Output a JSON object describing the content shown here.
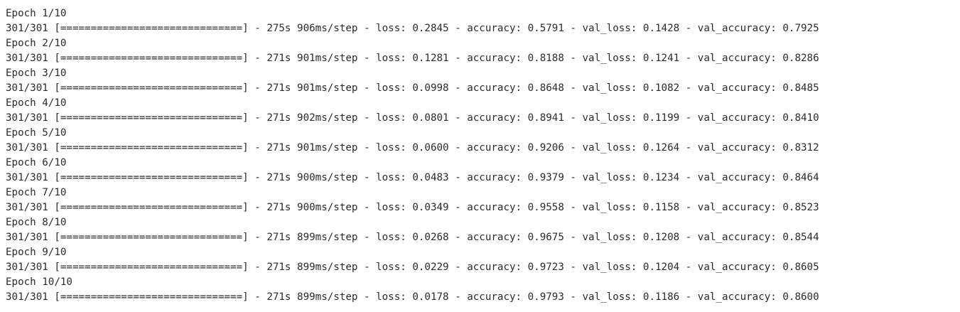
{
  "output": {
    "epochs": [
      {
        "header": "Epoch 1/10",
        "progress": {
          "text": "301/301",
          "fraction": 1.0
        },
        "bar": "[==============================]",
        "time": "275s",
        "step_time": "906ms/step",
        "loss": "0.2845",
        "accuracy": "0.5791",
        "val_loss": "0.1428",
        "val_accuracy": "0.7925"
      },
      {
        "header": "Epoch 2/10",
        "progress": {
          "text": "301/301",
          "fraction": 1.0
        },
        "bar": "[==============================]",
        "time": "271s",
        "step_time": "901ms/step",
        "loss": "0.1281",
        "accuracy": "0.8188",
        "val_loss": "0.1241",
        "val_accuracy": "0.8286"
      },
      {
        "header": "Epoch 3/10",
        "progress": {
          "text": "301/301",
          "fraction": 1.0
        },
        "bar": "[==============================]",
        "time": "271s",
        "step_time": "901ms/step",
        "loss": "0.0998",
        "accuracy": "0.8648",
        "val_loss": "0.1082",
        "val_accuracy": "0.8485"
      },
      {
        "header": "Epoch 4/10",
        "progress": {
          "text": "301/301",
          "fraction": 1.0
        },
        "bar": "[==============================]",
        "time": "271s",
        "step_time": "902ms/step",
        "loss": "0.0801",
        "accuracy": "0.8941",
        "val_loss": "0.1199",
        "val_accuracy": "0.8410"
      },
      {
        "header": "Epoch 5/10",
        "progress": {
          "text": "301/301",
          "fraction": 1.0
        },
        "bar": "[==============================]",
        "time": "271s",
        "step_time": "901ms/step",
        "loss": "0.0600",
        "accuracy": "0.9206",
        "val_loss": "0.1264",
        "val_accuracy": "0.8312"
      },
      {
        "header": "Epoch 6/10",
        "progress": {
          "text": "301/301",
          "fraction": 1.0
        },
        "bar": "[==============================]",
        "time": "271s",
        "step_time": "900ms/step",
        "loss": "0.0483",
        "accuracy": "0.9379",
        "val_loss": "0.1234",
        "val_accuracy": "0.8464"
      },
      {
        "header": "Epoch 7/10",
        "progress": {
          "text": "301/301",
          "fraction": 1.0
        },
        "bar": "[==============================]",
        "time": "271s",
        "step_time": "900ms/step",
        "loss": "0.0349",
        "accuracy": "0.9558",
        "val_loss": "0.1158",
        "val_accuracy": "0.8523"
      },
      {
        "header": "Epoch 8/10",
        "progress": {
          "text": "301/301",
          "fraction": 1.0
        },
        "bar": "[==============================]",
        "time": "271s",
        "step_time": "899ms/step",
        "loss": "0.0268",
        "accuracy": "0.9675",
        "val_loss": "0.1208",
        "val_accuracy": "0.8544"
      },
      {
        "header": "Epoch 9/10",
        "progress": {
          "text": "301/301",
          "fraction": 1.0
        },
        "bar": "[==============================]",
        "time": "271s",
        "step_time": "899ms/step",
        "loss": "0.0229",
        "accuracy": "0.9723",
        "val_loss": "0.1204",
        "val_accuracy": "0.8605"
      },
      {
        "header": "Epoch 10/10",
        "progress": {
          "text": "301/301",
          "fraction": 1.0
        },
        "bar": "[==============================]",
        "time": "271s",
        "step_time": "899ms/step",
        "loss": "0.0178",
        "accuracy": "0.9793",
        "val_loss": "0.1186",
        "val_accuracy": "0.8600"
      }
    ]
  },
  "colors": {
    "background": "#ffffff",
    "text": "#2b2b2b"
  }
}
